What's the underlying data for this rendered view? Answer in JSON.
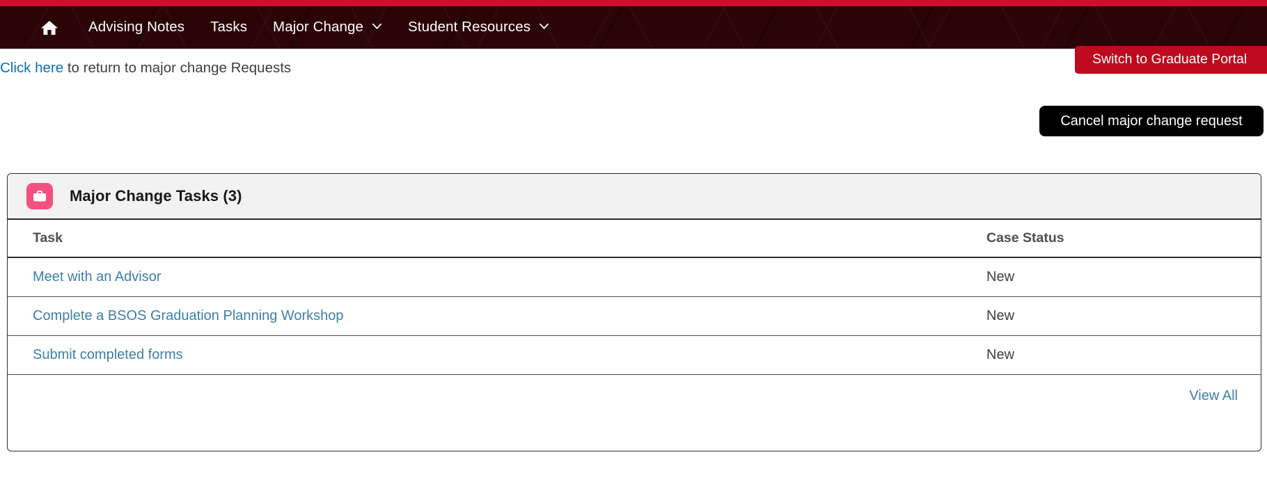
{
  "navbar": {
    "home_icon": "home-icon",
    "items": [
      {
        "label": "Advising Notes",
        "has_caret": false
      },
      {
        "label": "Tasks",
        "has_caret": false
      },
      {
        "label": "Major Change",
        "has_caret": true
      },
      {
        "label": "Student Resources",
        "has_caret": true
      }
    ],
    "bg_color": "#2B0407",
    "stripe_color": "#CE0E2D"
  },
  "return_notice": {
    "link_text": "Click here",
    "rest_text": " to return to major change Requests"
  },
  "buttons": {
    "switch_portal": "Switch to Graduate Portal",
    "switch_portal_color": "#BE0A1E",
    "cancel_request": "Cancel major change request",
    "cancel_request_color": "#000000"
  },
  "card": {
    "icon_name": "briefcase-icon",
    "icon_color": "#F4507F",
    "title": "Major Change Tasks (3)",
    "columns": [
      "Task",
      "Case Status"
    ],
    "rows": [
      {
        "task": "Meet with an Advisor",
        "status": "New"
      },
      {
        "task": "Complete a BSOS Graduation Planning Workshop",
        "status": "New"
      },
      {
        "task": "Submit completed forms",
        "status": "New"
      }
    ],
    "footer_link": "View All",
    "link_color": "#3D7FA6"
  }
}
